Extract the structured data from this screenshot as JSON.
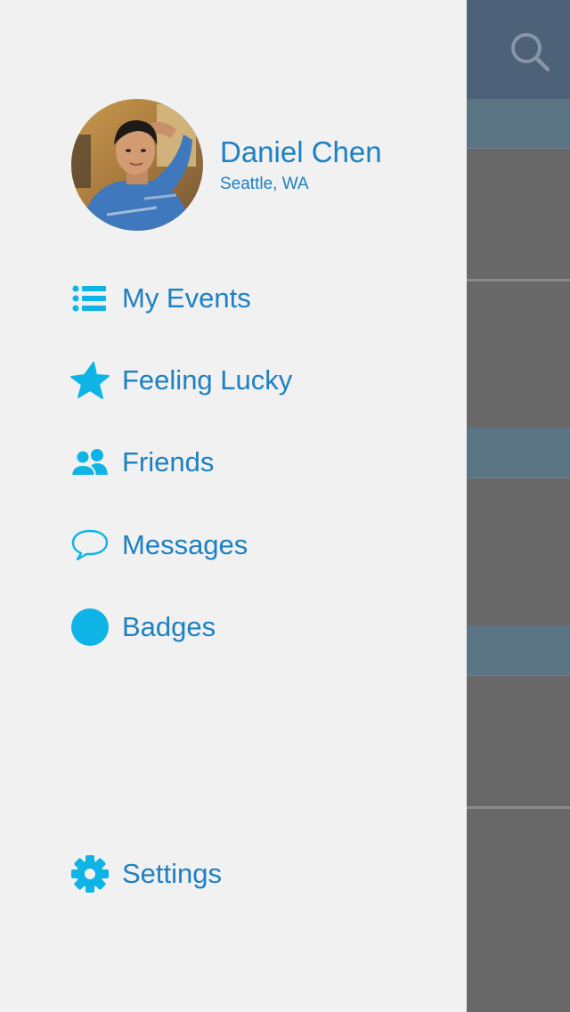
{
  "profile": {
    "name": "Daniel Chen",
    "location": "Seattle, WA"
  },
  "menu": {
    "items": [
      {
        "label": "My Events",
        "icon": "list-icon"
      },
      {
        "label": "Feeling Lucky",
        "icon": "star-icon"
      },
      {
        "label": "Friends",
        "icon": "friends-icon"
      },
      {
        "label": "Messages",
        "icon": "chat-bubble-icon"
      },
      {
        "label": "Badges",
        "icon": "badge-circle-icon"
      }
    ],
    "settings": {
      "label": "Settings",
      "icon": "gear-icon"
    }
  },
  "main": {
    "search_icon": "search-icon"
  },
  "colors": {
    "accent_text": "#1d80c3",
    "accent_icon": "#0fb4e6",
    "drawer_bg": "#f1f1f1",
    "topbar_bg": "#4d6178",
    "section_header_bg": "#5b7584",
    "content_bg": "#686868"
  }
}
